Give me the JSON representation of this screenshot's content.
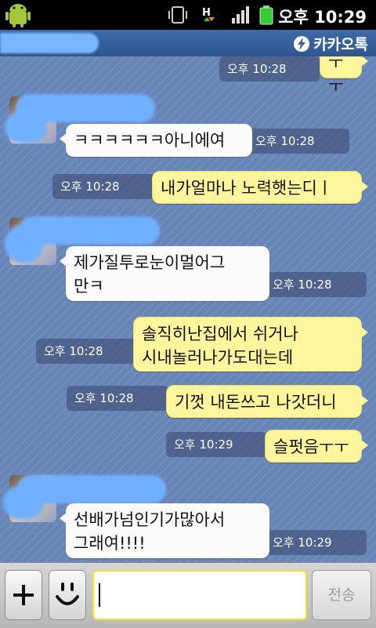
{
  "status_bar": {
    "time": "오후 10:29",
    "icons": [
      "android-icon",
      "vibrate-icon",
      "h-data-icon",
      "signal-icon",
      "battery-icon"
    ]
  },
  "title_bar": {
    "app_name": "카카오톡"
  },
  "messages": [
    {
      "side": "right",
      "text": "ㅜㅜ",
      "time": "오후 10:28"
    },
    {
      "side": "left",
      "text": "ㅋㅋㅋㅋㅋㅋ아니에여",
      "time": "오후 10:28"
    },
    {
      "side": "right",
      "text": "내가얼마나 노력햇는디ㅣ",
      "time": "오후 10:28"
    },
    {
      "side": "left",
      "text_line1": "제가질투로눈이멀어그",
      "text_line2": "만ㅋ",
      "time": "오후 10:28"
    },
    {
      "side": "right",
      "text_line1": "솔직히난집에서 쉬거나",
      "text_line2": "시내놀러나가도대는데",
      "time": "오후 10:28"
    },
    {
      "side": "right",
      "text": "기껏 내돈쓰고 나갓더니",
      "time": "오후 10:28"
    },
    {
      "side": "right",
      "text": "슬펏음ㅜㅜ",
      "time": "오후 10:29"
    },
    {
      "side": "left",
      "text_line1": "선배가넘인기가많아서",
      "text_line2": "그래여!!!!",
      "time": "오후 10:29"
    }
  ],
  "input_bar": {
    "input_value": "",
    "send_label": "전송"
  },
  "colors": {
    "chat_background": "#6885b8",
    "my_bubble": "#fff59c",
    "their_bubble": "#fbfbfb",
    "title_bar": "#3a629e"
  }
}
